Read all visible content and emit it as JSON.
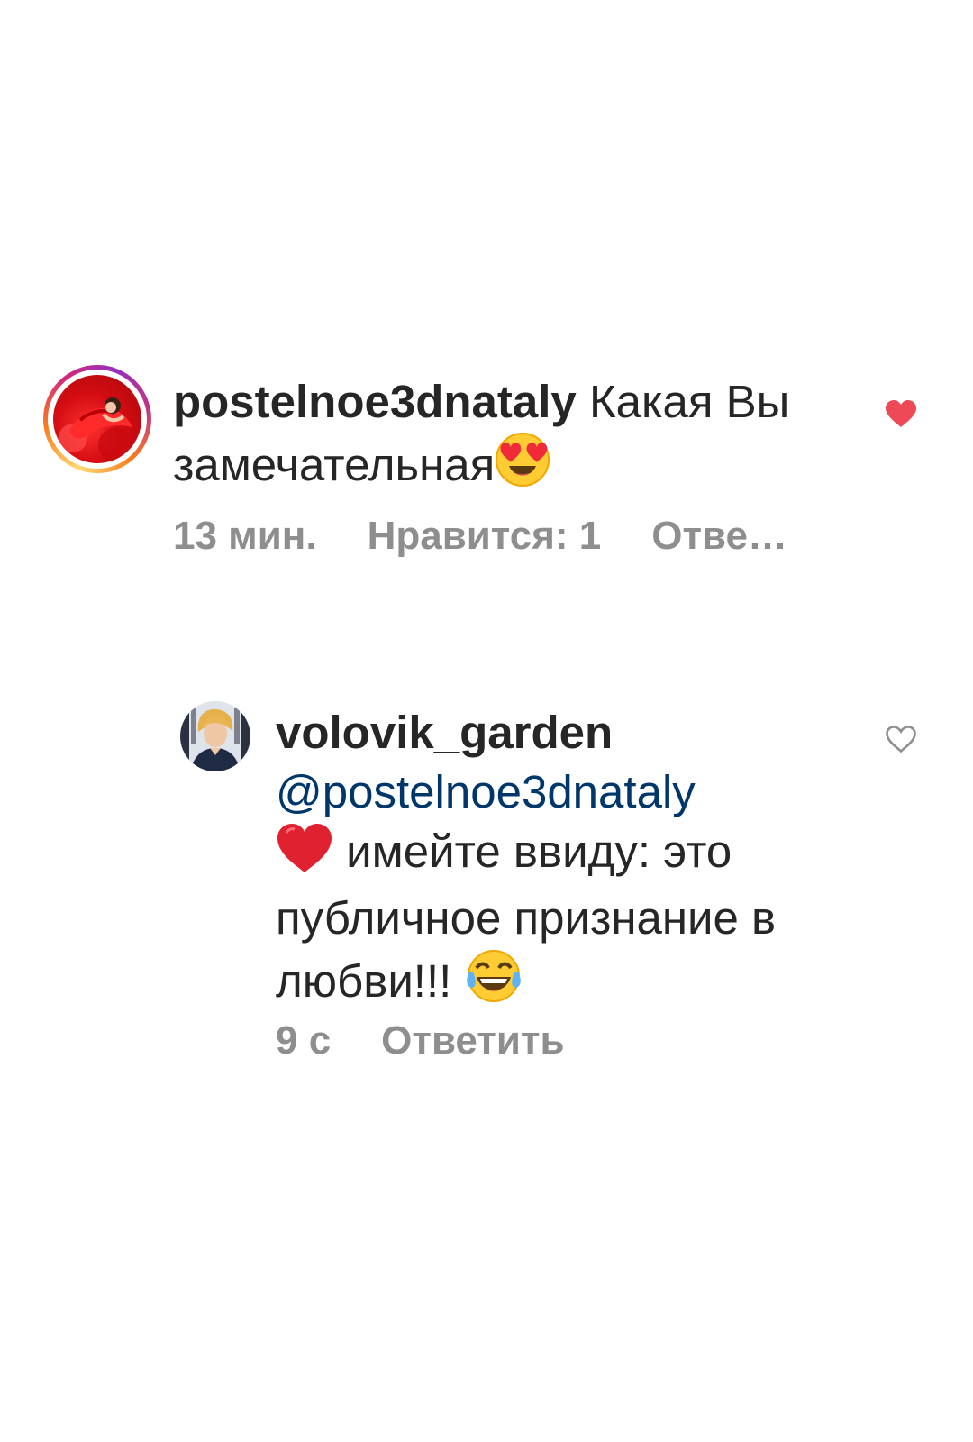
{
  "comments": [
    {
      "username": "postelnoe3dnataly",
      "text_part1": " Какая Вы ",
      "text_part2": "замечательная",
      "emoji_after": "heart-eyes-emoji",
      "time": "13 мин.",
      "likes": "Нравится: 1",
      "reply": "Отве…",
      "liked": true,
      "has_story_ring": true
    },
    {
      "username": "volovik_garden",
      "mention": "@postelnoe3dnataly",
      "line_emoji": "red-heart-emoji",
      "text_part1": " имейте ввиду: это публичное признание в любви!!! ",
      "emoji_after": "tears-of-joy-emoji",
      "time": "9 с",
      "reply": "Ответить",
      "liked": false
    }
  ],
  "colors": {
    "like_active": "#ed4956",
    "meta_gray": "#8e8e8e",
    "mention_blue": "#00376b",
    "text": "#262626"
  }
}
